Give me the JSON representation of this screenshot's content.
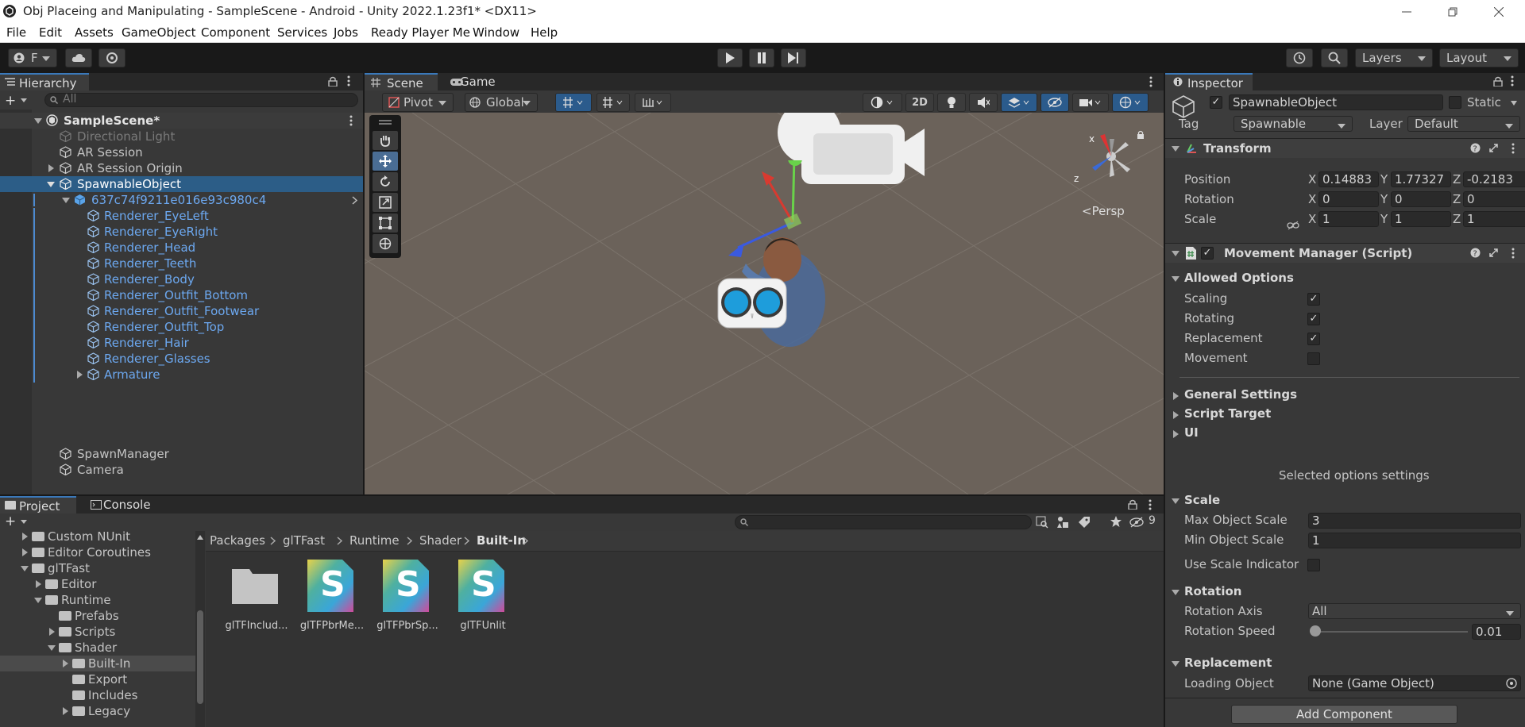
{
  "window": {
    "title": "Obj Placeing and Manipulating - SampleScene - Android - Unity 2022.1.23f1* <DX11>"
  },
  "menu": [
    "File",
    "Edit",
    "Assets",
    "GameObject",
    "Component",
    "Services",
    "Jobs",
    "Ready Player Me",
    "Window",
    "Help"
  ],
  "toolbar": {
    "account_label": "F",
    "layers_label": "Layers",
    "layout_label": "Layout"
  },
  "hierarchy": {
    "tab_label": "Hierarchy",
    "search_placeholder": "All",
    "items": [
      {
        "label": "SampleScene*",
        "style": "scene"
      },
      {
        "label": "Directional Light",
        "style": "disabled"
      },
      {
        "label": "AR Session",
        "style": "normal"
      },
      {
        "label": "AR Session Origin",
        "style": "normal"
      },
      {
        "label": "SpawnableObject",
        "style": "selected"
      },
      {
        "label": "637c74f9211e016e93c980c4",
        "style": "prefab"
      },
      {
        "label": "Renderer_EyeLeft",
        "style": "prefab-child"
      },
      {
        "label": "Renderer_EyeRight",
        "style": "prefab-child"
      },
      {
        "label": "Renderer_Head",
        "style": "prefab-child"
      },
      {
        "label": "Renderer_Teeth",
        "style": "prefab-child"
      },
      {
        "label": "Renderer_Body",
        "style": "prefab-child"
      },
      {
        "label": "Renderer_Outfit_Bottom",
        "style": "prefab-child"
      },
      {
        "label": "Renderer_Outfit_Footwear",
        "style": "prefab-child"
      },
      {
        "label": "Renderer_Outfit_Top",
        "style": "prefab-child"
      },
      {
        "label": "Renderer_Hair",
        "style": "prefab-child"
      },
      {
        "label": "Renderer_Glasses",
        "style": "prefab-child"
      },
      {
        "label": "Armature",
        "style": "prefab-child"
      },
      {
        "label": "SpawnManager",
        "style": "normal"
      },
      {
        "label": "Camera",
        "style": "normal"
      }
    ]
  },
  "scene": {
    "tabs": [
      "Scene",
      "Game"
    ],
    "pivot_label": "Pivot",
    "global_label": "Global",
    "mode_2d": "2D",
    "persp_label": "Persp",
    "gizmo_x": "x",
    "gizmo_z": "z"
  },
  "project": {
    "tabs": [
      "Project",
      "Console"
    ],
    "hidden_count": "9",
    "breadcrumb": [
      "Packages",
      "glTFast",
      "Runtime",
      "Shader",
      "Built-In"
    ],
    "tree": [
      {
        "label": "Custom NUnit"
      },
      {
        "label": "Editor Coroutines"
      },
      {
        "label": "glTFast"
      },
      {
        "label": "Editor"
      },
      {
        "label": "Runtime"
      },
      {
        "label": "Prefabs"
      },
      {
        "label": "Scripts"
      },
      {
        "label": "Shader"
      },
      {
        "label": "Built-In"
      },
      {
        "label": "Export"
      },
      {
        "label": "Includes"
      },
      {
        "label": "Legacy"
      }
    ],
    "assets": [
      {
        "label": "glTFInclud..."
      },
      {
        "label": "glTFPbrMe..."
      },
      {
        "label": "glTFPbrSp..."
      },
      {
        "label": "glTFUnlit"
      }
    ],
    "shader_glyph": "S"
  },
  "inspector": {
    "tab_label": "Inspector",
    "object_name": "SpawnableObject",
    "static_label": "Static",
    "tag_label": "Tag",
    "tag_value": "Spawnable",
    "layer_label": "Layer",
    "layer_value": "Default",
    "transform": {
      "header": "Transform",
      "position_label": "Position",
      "rotation_label": "Rotation",
      "scale_label": "Scale",
      "axis_x": "X",
      "axis_y": "Y",
      "axis_z": "Z",
      "position": [
        "0.14883",
        "1.77327",
        "-0.2183"
      ],
      "rotation": [
        "0",
        "0",
        "0"
      ],
      "scale": [
        "1",
        "1",
        "1"
      ]
    },
    "script": {
      "header": "Movement Manager (Script)",
      "allowed_options": "Allowed Options",
      "options": [
        {
          "label": "Scaling",
          "checked": true
        },
        {
          "label": "Rotating",
          "checked": true
        },
        {
          "label": "Replacement",
          "checked": true
        },
        {
          "label": "Movement",
          "checked": false
        }
      ],
      "foldouts": [
        "General Settings",
        "Script Target",
        "UI"
      ],
      "selected_options": "Selected options settings",
      "scale_section": "Scale",
      "max_scale_label": "Max Object Scale",
      "max_scale_value": "3",
      "min_scale_label": "Min Object Scale",
      "min_scale_value": "1",
      "use_scale_indicator_label": "Use Scale Indicator",
      "rotation_section": "Rotation",
      "rotation_axis_label": "Rotation Axis",
      "rotation_axis_value": "All",
      "rotation_speed_label": "Rotation Speed",
      "rotation_speed_value": "0.01",
      "rotation_speed_fraction": 0.01,
      "replacement_section": "Replacement",
      "loading_object_label": "Loading Object",
      "loading_object_value": "None (Game Object)"
    },
    "add_component_label": "Add Component"
  }
}
